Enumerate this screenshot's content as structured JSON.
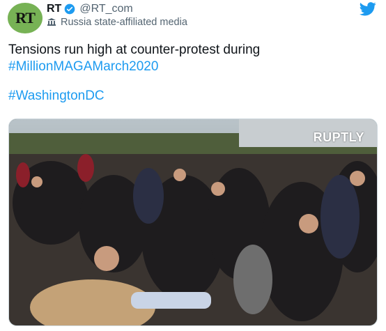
{
  "account": {
    "avatar_text": "RT",
    "display_name": "RT",
    "handle": "@RT_com",
    "label": "Russia state-affiliated media",
    "verified_icon": "verified-badge-icon",
    "label_icon": "flag-icon"
  },
  "tweet": {
    "line1": "Tensions run high at counter-protest during",
    "hashtag1": "#MillionMAGAMarch2020",
    "hashtag2": "#WashingtonDC"
  },
  "media": {
    "watermark": "RUPTLY"
  },
  "brand_icon": "twitter-bird-icon",
  "colors": {
    "link": "#1d9bf0",
    "avatar_bg": "#77b255",
    "muted": "#536471"
  }
}
